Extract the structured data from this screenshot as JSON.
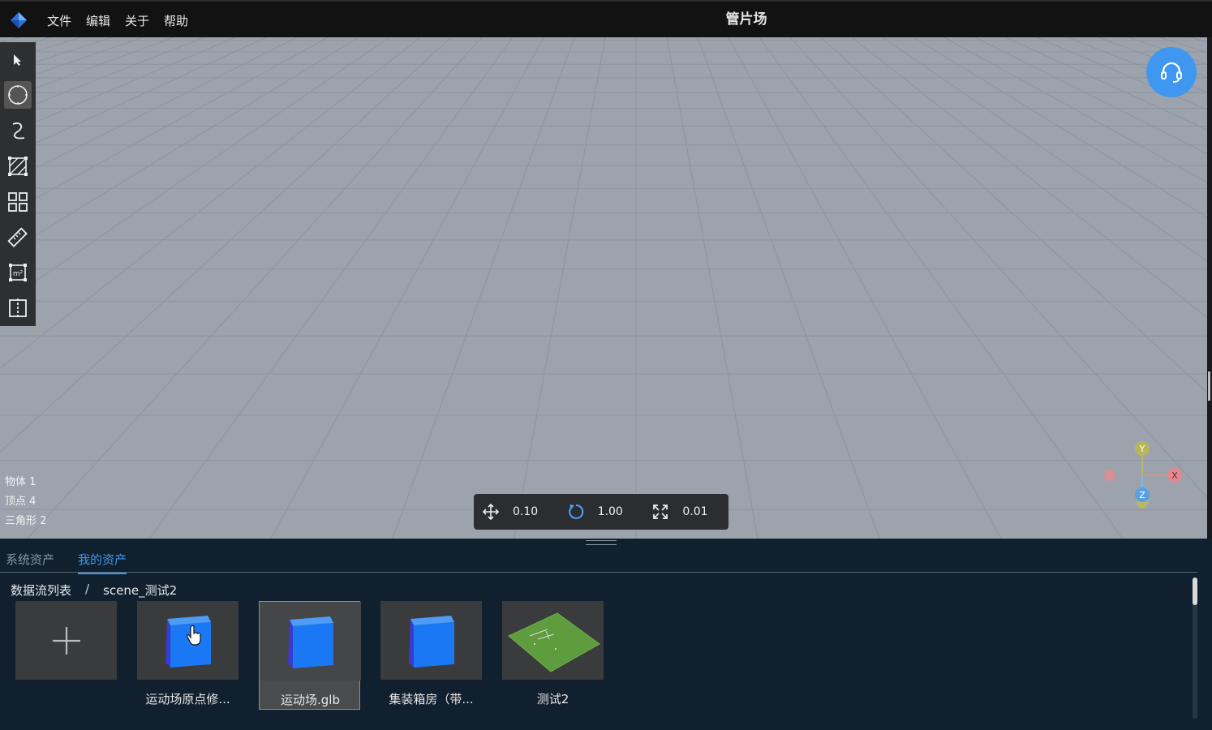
{
  "app": {
    "title": "管片场",
    "menu": [
      {
        "label": "文件"
      },
      {
        "label": "编辑"
      },
      {
        "label": "关于"
      },
      {
        "label": "帮助"
      }
    ]
  },
  "toolbar": {
    "tools": [
      {
        "icon": "pointer-icon"
      },
      {
        "icon": "circle-icon",
        "active": true
      },
      {
        "icon": "curve-icon"
      },
      {
        "icon": "hatched-square-icon"
      },
      {
        "icon": "grid-icon"
      },
      {
        "icon": "ruler-icon"
      },
      {
        "icon": "area-measure-icon"
      },
      {
        "icon": "split-panel-icon"
      }
    ]
  },
  "stats": {
    "objects": "物体 1",
    "vertices": "顶点 4",
    "triangles": "三角形 2"
  },
  "transform": {
    "translate": "0.10",
    "rotate": "1.00",
    "scale": "0.01"
  },
  "axes": {
    "x": "X",
    "y": "Y",
    "z": "Z"
  },
  "panel": {
    "tabs": [
      {
        "label": "系统资产",
        "active": false
      },
      {
        "label": "我的资产",
        "active": true
      }
    ],
    "breadcrumb": {
      "root": "数据流列表",
      "separator": "/",
      "current": "scene_测试2"
    },
    "assets": [
      {
        "label": "",
        "type": "add"
      },
      {
        "label": "运动场原点修...",
        "type": "cube"
      },
      {
        "label": "运动场.glb",
        "type": "cube",
        "selected": true
      },
      {
        "label": "集装箱房（带...",
        "type": "cube"
      },
      {
        "label": "测试2",
        "type": "field"
      }
    ]
  },
  "colors": {
    "accent": "#3f97ef",
    "viewport": "#9da3ad",
    "panel": "#10202f",
    "cube": "#1a78f5"
  }
}
